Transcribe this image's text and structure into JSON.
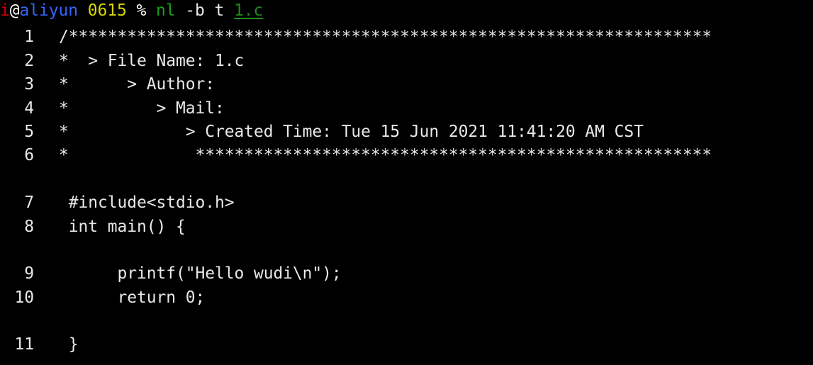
{
  "terminal": {
    "background_color": "#000000",
    "foreground_color": "#e8e8e8",
    "prompt": {
      "user": "i",
      "at": "@",
      "host": "aliyun",
      "directory": "0615",
      "symbol": "%",
      "command": "nl",
      "args": "-b t",
      "file": "1.c",
      "colors": {
        "user": "#cc0000",
        "host": "#3465ff",
        "directory": "#d7d700",
        "command": "#19a019",
        "file": "#1f8a1f",
        "text": "#e8e8e8"
      }
    },
    "output": {
      "command_name": "nl",
      "rows": [
        {
          "number": "1",
          "text": "/******************************************************************"
        },
        {
          "number": "2",
          "text": "*  > File Name: 1.c"
        },
        {
          "number": "3",
          "text": "*      > Author: "
        },
        {
          "number": "4",
          "text": "*         > Mail: "
        },
        {
          "number": "5",
          "text": "*            > Created Time: Tue 15 Jun 2021 11:41:20 AM CST"
        },
        {
          "number": "6",
          "text": "*             *****************************************************"
        },
        {
          "number": "",
          "text": ""
        },
        {
          "number": "7",
          "text": " #include<stdio.h>"
        },
        {
          "number": "8",
          "text": " int main() {"
        },
        {
          "number": "",
          "text": ""
        },
        {
          "number": "9",
          "text": "      printf(\"Hello wudi\\n\");"
        },
        {
          "number": "10",
          "text": "      return 0;"
        },
        {
          "number": "",
          "text": ""
        },
        {
          "number": "11",
          "text": " }"
        }
      ]
    }
  }
}
